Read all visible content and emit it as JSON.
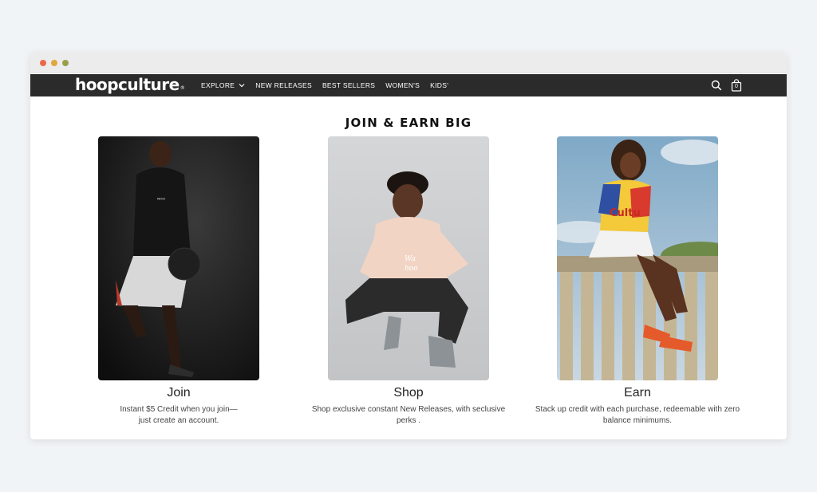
{
  "brand": {
    "logo_text": "hoopculture",
    "logo_mark": "®"
  },
  "nav": {
    "items": [
      {
        "label": "EXPLORE",
        "has_dropdown": true
      },
      {
        "label": "NEW RELEASES"
      },
      {
        "label": "BEST SELLERS"
      },
      {
        "label": "WOMEN'S"
      },
      {
        "label": "KIDS'"
      }
    ],
    "cart_count": "0",
    "icons": [
      "search-icon",
      "shopping-bag-icon"
    ]
  },
  "page": {
    "headline": "JOIN & EARN BIG"
  },
  "cards": [
    {
      "title": "Join",
      "description": "Instant $5 Credit when you join—\njust create an account.",
      "image": "model-holding-basketball"
    },
    {
      "title": "Shop",
      "description": "Shop exclusive constant New Releases, with seclusive\nperks .",
      "image": "model-crouching-smiling"
    },
    {
      "title": "Earn",
      "description": "Stack up credit with each purchase, redeemable with zero\nbalance minimums.",
      "image": "model-sitting-on-balustrade"
    }
  ],
  "colors": {
    "navbar_bg": "#2b2b2b",
    "page_bg": "#f1f4f6"
  }
}
